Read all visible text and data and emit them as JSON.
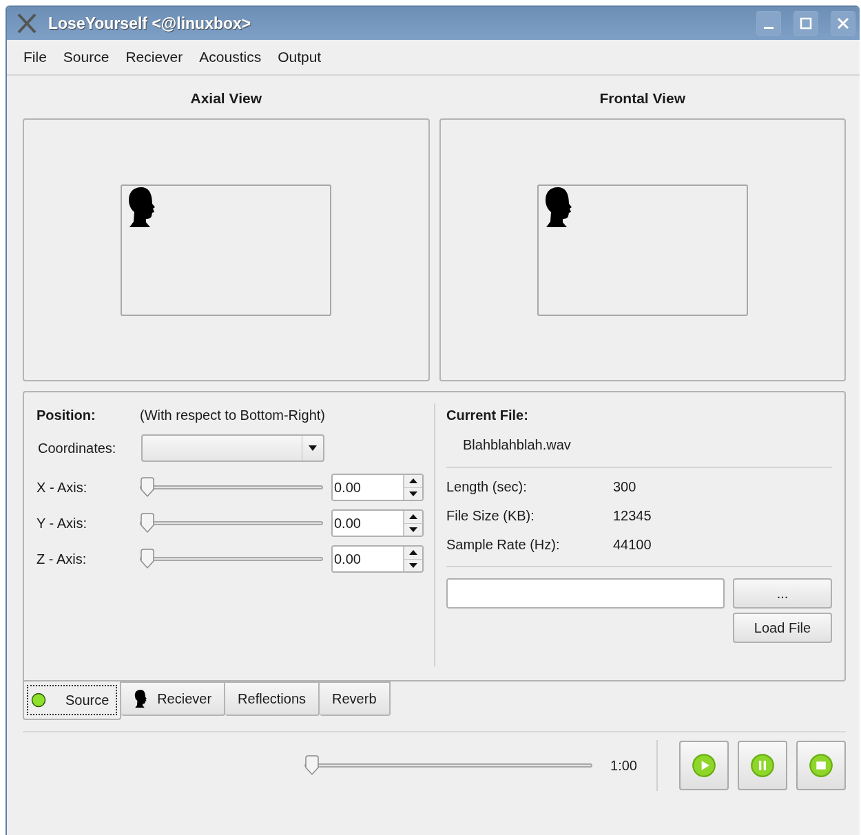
{
  "window": {
    "title": "LoseYourself <@linuxbox>"
  },
  "menu": [
    "File",
    "Source",
    "Reciever",
    "Acoustics",
    "Output"
  ],
  "views": [
    {
      "title": "Axial View"
    },
    {
      "title": "Frontal View"
    }
  ],
  "position": {
    "label": "Position:",
    "note": "(With respect to Bottom-Right)",
    "coordinates_label": "Coordinates:",
    "axes": [
      {
        "label": "X - Axis:",
        "level": 0,
        "value": "0.00"
      },
      {
        "label": "Y - Axis:",
        "level": 0,
        "value": "0.00"
      },
      {
        "label": "Z - Axis:",
        "level": 0,
        "value": "0.00"
      }
    ]
  },
  "file": {
    "label": "Current File:",
    "name": "Blahblahblah.wav",
    "info": [
      {
        "label": "Length (sec):",
        "value": "300"
      },
      {
        "label": "File Size (KB):",
        "value": "12345"
      },
      {
        "label": "Sample Rate (Hz):",
        "value": "44100"
      }
    ],
    "browse_button": "...",
    "load_button": "Load File"
  },
  "tabs": [
    {
      "label": "Source",
      "kind": "dot",
      "selected": true
    },
    {
      "label": "Reciever",
      "kind": "head",
      "selected": false
    },
    {
      "label": "Reflections",
      "kind": "plain",
      "selected": false
    },
    {
      "label": "Reverb",
      "kind": "plain",
      "selected": false
    }
  ],
  "playback": {
    "level": 0,
    "time": "1:00",
    "buttons": [
      {
        "kind": "play"
      },
      {
        "kind": "pause"
      },
      {
        "kind": "stop"
      }
    ]
  }
}
